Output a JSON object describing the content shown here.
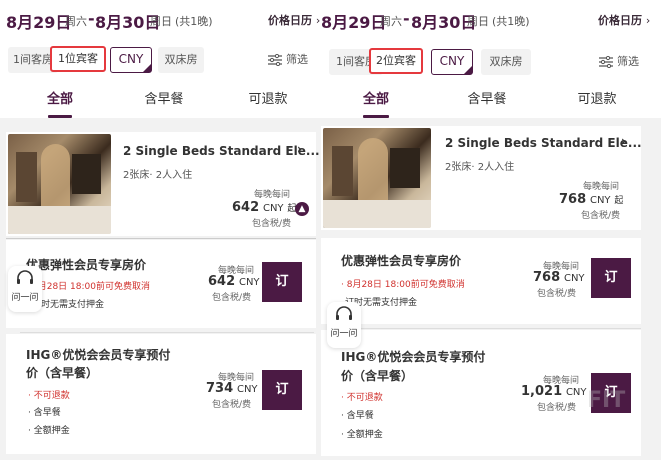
{
  "left": {
    "header": {
      "checkin": "8月29日",
      "checkin_dow": "周六",
      "dash": "-",
      "checkout": "8月30日",
      "checkout_dow": "周日",
      "nights": "(共1晚)",
      "calendar_label": "价格日历",
      "calendar_chevron": "›"
    },
    "chips": {
      "rooms": "1间客房",
      "guests": "1位宾客",
      "currency": "CNY",
      "bed": "双床房",
      "filter": "筛选"
    },
    "tabs": [
      "全部",
      "含早餐",
      "可退款"
    ],
    "room": {
      "title": "2 Single Beds Standard Ele...",
      "chevron": "›",
      "sub": "2张床· 2人入住",
      "per_night": "每晚每间",
      "price": "642",
      "currency": "CNY",
      "suffix": "起",
      "tax": "包含税/费"
    },
    "rate1": {
      "title": "优惠弹性会员专享房价",
      "policy": "8月28日 18:00前可免费取消",
      "note": "订时无需支付押金",
      "per_night": "每晚每间",
      "price": "642",
      "currency": "CNY",
      "tax": "包含税/费",
      "book": "订"
    },
    "rate2": {
      "title_line1": "IHG®优悦会会员专享预付",
      "title_line2": "价（含早餐）",
      "policy": "· 不可退款",
      "b1": "· 含早餐",
      "b2": "· 全额押金",
      "per_night": "每晚每间",
      "price": "734",
      "currency": "CNY",
      "tax": "包含税/费",
      "book": "订"
    },
    "ask": "问一问"
  },
  "right": {
    "header": {
      "checkin": "8月29日",
      "checkin_dow": "周六",
      "dash": "-",
      "checkout": "8月30日",
      "checkout_dow": "周日",
      "nights": "(共1晚)",
      "calendar_label": "价格日历",
      "calendar_chevron": "›"
    },
    "chips": {
      "rooms": "1间客房",
      "guests": "2位宾客",
      "currency": "CNY",
      "bed": "双床房",
      "filter": "筛选"
    },
    "tabs": [
      "全部",
      "含早餐",
      "可退款"
    ],
    "room": {
      "title": "2 Single Beds Standard Ele...",
      "chevron": "›",
      "sub": "2张床· 2人入住",
      "per_night": "每晚每间",
      "price": "768",
      "currency": "CNY",
      "suffix": "起",
      "tax": "包含税/费"
    },
    "rate1": {
      "title": "优惠弹性会员专享房价",
      "policy": "· 8月28日 18:00前可免费取消",
      "note": "订时无需支付押金",
      "per_night": "每晚每间",
      "price": "768",
      "currency": "CNY",
      "tax": "包含税/费",
      "book": "订"
    },
    "rate2": {
      "title_line1": "IHG®优悦会会员专享预付",
      "title_line2": "价（含早餐）",
      "policy": "· 不可退款",
      "b1": "· 含早餐",
      "b2": "· 全额押金",
      "per_night": "每晚每间",
      "price": "1,021",
      "currency": "CNY",
      "tax": "包含税/费",
      "book": "订"
    },
    "ask": "问一问",
    "watermark": "FIT"
  },
  "colors": {
    "brand": "#4b1a44",
    "highlight": "#e5393e",
    "warning": "#d0312d"
  }
}
